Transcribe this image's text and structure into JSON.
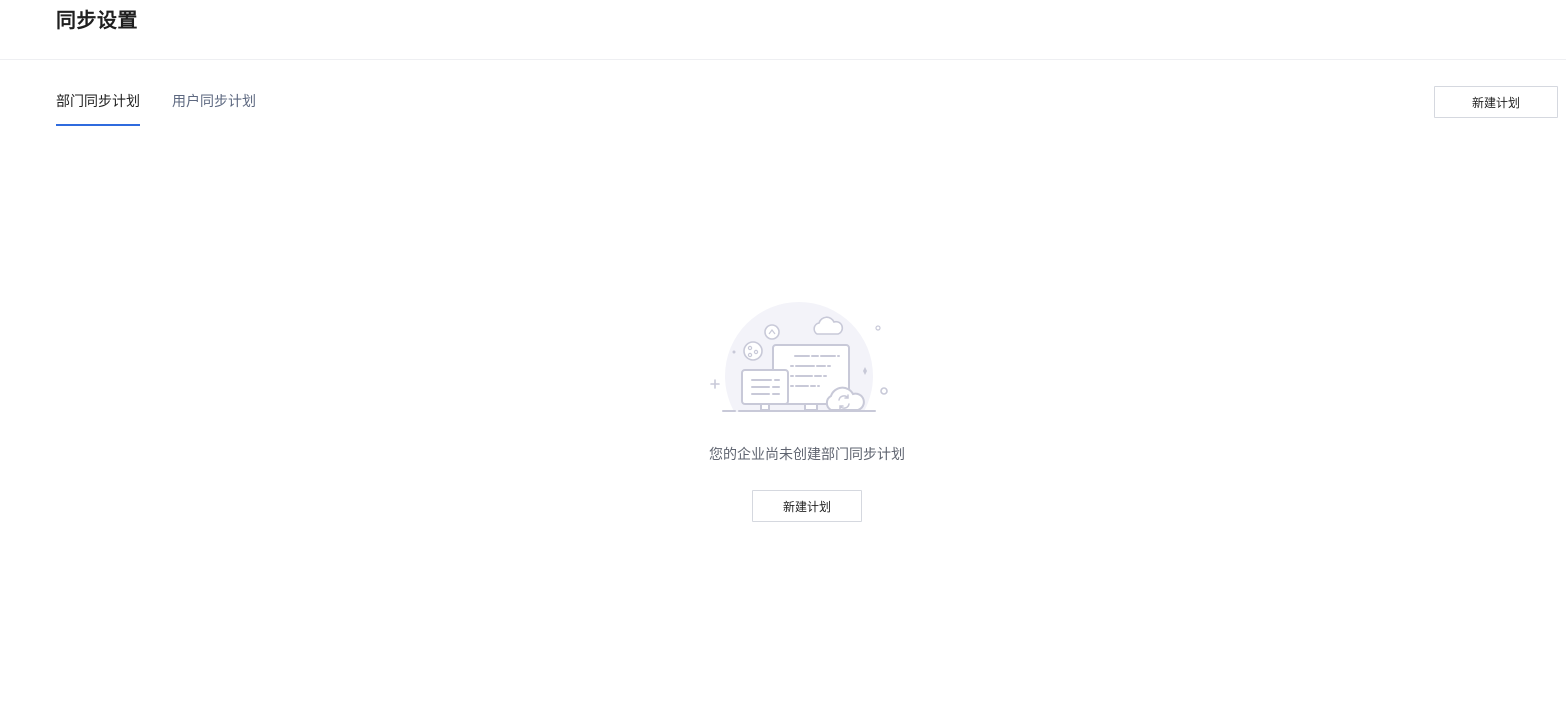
{
  "header": {
    "title": "同步设置"
  },
  "tabs": [
    {
      "label": "部门同步计划",
      "active": true
    },
    {
      "label": "用户同步计划",
      "active": false
    }
  ],
  "toolbar": {
    "new_plan_label": "新建计划"
  },
  "empty_state": {
    "message": "您的企业尚未创建部门同步计划",
    "button_label": "新建计划",
    "illustration_icon": "empty-sync-illustration-icon"
  },
  "colors": {
    "accent": "#2f6bde",
    "illustration": "#c8c9d8",
    "illustration_bg": "#f3f3f9"
  }
}
